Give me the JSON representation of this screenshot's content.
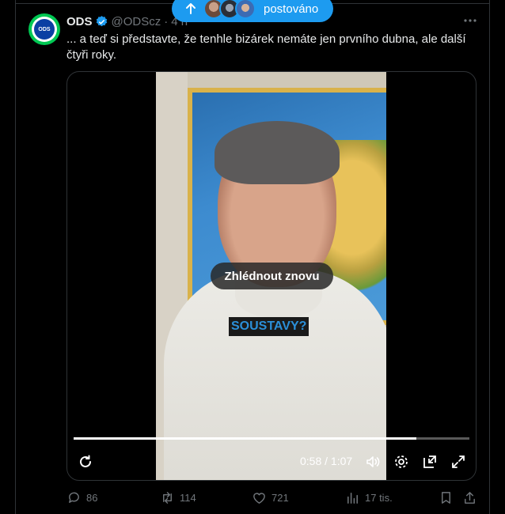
{
  "banner": {
    "label": "postováno"
  },
  "tweet": {
    "avatar_text": "ODS",
    "name": "ODS",
    "handle": "@ODScz",
    "separator": "·",
    "time": "4 h",
    "text": "... a teď si představte, že tenhle bizárek nemáte jen prvního dubna, ale další čtyři roky."
  },
  "video": {
    "replay_label": "Zhlédnout znovu",
    "caption": "SOUSTAVY?",
    "elapsed": "0:58",
    "duration": "1:07",
    "time_display": "0:58 / 1:07",
    "progress_fraction": 0.866
  },
  "actions": {
    "replies": "86",
    "reposts": "114",
    "likes": "721",
    "views": "17 tis."
  },
  "colors": {
    "accent": "#1d9bf0",
    "verified": "#1d9bf0",
    "muted": "#71767b",
    "avatar_ring": "#00c853"
  },
  "icons": [
    "arrow-up-icon",
    "verified-badge-icon",
    "more-icon",
    "replay-icon",
    "volume-icon",
    "settings-icon",
    "pip-icon",
    "fullscreen-icon",
    "reply-icon",
    "repost-icon",
    "like-icon",
    "views-icon",
    "bookmark-icon",
    "share-icon"
  ]
}
